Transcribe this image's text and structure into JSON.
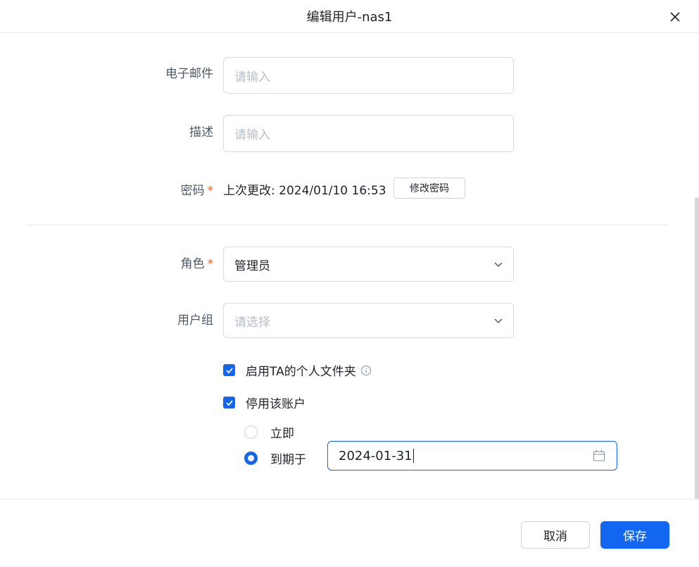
{
  "dialog": {
    "title": "编辑用户-nas1"
  },
  "form": {
    "email": {
      "label": "电子邮件",
      "placeholder": "请输入",
      "value": ""
    },
    "description": {
      "label": "描述",
      "placeholder": "请输入",
      "value": ""
    },
    "password": {
      "label": "密码",
      "required_mark": "*",
      "last_changed": "上次更改: 2024/01/10 16:53",
      "change_button": "修改密码"
    },
    "role": {
      "label": "角色",
      "required_mark": "*",
      "selected": "管理员"
    },
    "user_group": {
      "label": "用户组",
      "placeholder": "请选择"
    },
    "personal_folder": {
      "label": "启用TA的个人文件夹",
      "checked": true
    },
    "disable_account": {
      "label": "停用该账户",
      "checked": true,
      "options": [
        {
          "label": "立即",
          "selected": false
        },
        {
          "label": "到期于",
          "selected": true
        }
      ],
      "expire_date": "2024-01-31"
    }
  },
  "footer": {
    "cancel_label": "取消",
    "save_label": "保存"
  },
  "colors": {
    "accent": "#1366f0",
    "required": "#e8683a",
    "placeholder": "#b8bec8"
  }
}
